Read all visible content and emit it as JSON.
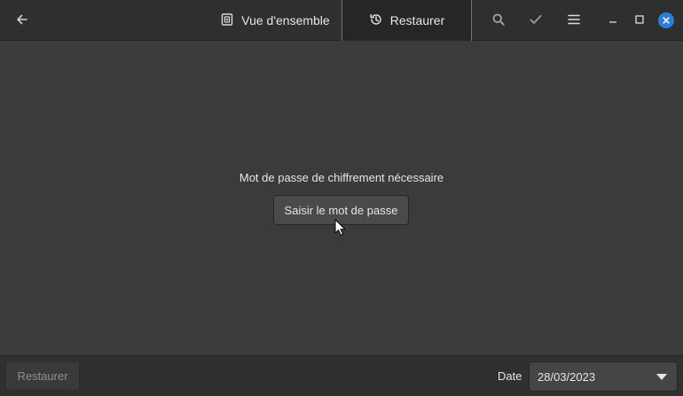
{
  "header": {
    "back_icon": "arrow-left-icon",
    "tabs": [
      {
        "label": "Vue d'ensemble",
        "icon": "overview-icon",
        "active": false
      },
      {
        "label": "Restaurer",
        "icon": "history-icon",
        "active": true
      }
    ],
    "actions": [
      "search-icon",
      "check-icon",
      "menu-icon"
    ],
    "window_controls": [
      "minimize-icon",
      "maximize-icon",
      "close-icon"
    ],
    "accent_color": "#3a82c8",
    "close_color": "#2b7fd8"
  },
  "main": {
    "message": "Mot de passe de chiffrement nécessaire",
    "button_label": "Saisir le mot de passe"
  },
  "footer": {
    "restore_label": "Restaurer",
    "restore_enabled": false,
    "date_label": "Date",
    "date_value": "28/03/2023"
  }
}
